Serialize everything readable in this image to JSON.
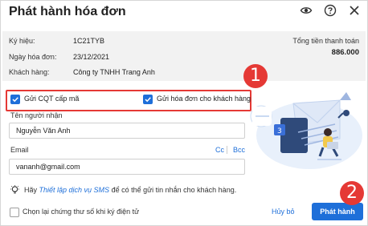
{
  "dialog": {
    "title": "Phát hành hóa đơn",
    "icons": [
      "eye-icon",
      "help-icon",
      "close-icon"
    ]
  },
  "info": {
    "rows": [
      {
        "label": "Ký hiệu:",
        "value": "1C21TYB"
      },
      {
        "label": "Ngày hóa đơn:",
        "value": "23/12/2021"
      },
      {
        "label": "Khách hàng:",
        "value": "Công ty TNHH Trang Anh"
      }
    ],
    "total_label": "Tổng tiền thanh toán",
    "total_value": "886.000"
  },
  "options": {
    "send_cqt": {
      "label": "Gửi CQT cấp mã",
      "checked": true
    },
    "send_customer": {
      "label": "Gửi hóa đơn cho khách hàng",
      "checked": true
    }
  },
  "recipient": {
    "name_label": "Tên người nhận",
    "name_value": "Nguyễn Văn Anh",
    "email_label": "Email",
    "email_value": "vananh@gmail.com",
    "cc_label": "Cc",
    "bcc_label": "Bcc"
  },
  "hint": {
    "prefix": "Hãy ",
    "link": "Thiết lập dịch vụ SMS",
    "suffix": " để có thể gửi tin nhắn cho khách hàng."
  },
  "footer": {
    "reselect_cert_label": "Chọn lại chứng thư số khi ký điện tử",
    "cancel_label": "Hủy bỏ",
    "publish_label": "Phát hành"
  },
  "annotations": {
    "badge1": "1",
    "badge2": "2"
  },
  "colors": {
    "accent": "#1e6fd9",
    "annotation": "#e53935",
    "info_bg": "#f2f2f2"
  }
}
